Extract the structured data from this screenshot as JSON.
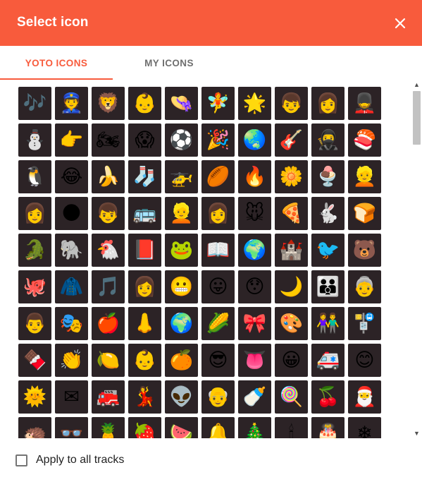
{
  "dialog": {
    "title": "Select icon"
  },
  "tabs": [
    {
      "label": "YOTO ICONS",
      "active": true
    },
    {
      "label": "MY ICONS",
      "active": false
    }
  ],
  "footer": {
    "apply_label": "Apply to all tracks",
    "apply_checked": false
  },
  "colors": {
    "accent": "#f85b3c",
    "tile_bg": "#2c2326"
  },
  "icons": [
    [
      "🎶",
      "👮",
      "🦁",
      "👶",
      "👒",
      "🧚",
      "🌟",
      "👦",
      "👩",
      "💂"
    ],
    [
      "⛄",
      "👉",
      "🏍",
      "😱",
      "⚽",
      "🎉",
      "🌏",
      "🎸",
      "🥷",
      "🍣"
    ],
    [
      "🐧",
      "😂",
      "🍌",
      "🧦",
      "🚁",
      "🏉",
      "🔥",
      "🌼",
      "🍨",
      "👱"
    ],
    [
      "👩",
      "🌑",
      "👦",
      "🚌",
      "👱",
      "👩",
      "🐭",
      "🍕",
      "🐇",
      "🍞"
    ],
    [
      "🐊",
      "🐘",
      "🐔",
      "📕",
      "🐸",
      "📖",
      "🌍",
      "🏰",
      "🐦",
      "🐻"
    ],
    [
      "🐙",
      "🧥",
      "🎵",
      "👩",
      "😬",
      "😛",
      "😯",
      "🌙",
      "👪",
      "👵"
    ],
    [
      "👨",
      "🎭",
      "🍎",
      "👃",
      "🌍",
      "🌽",
      "🎀",
      "🎨",
      "👫",
      "🚏"
    ],
    [
      "🍫",
      "👏",
      "🍋",
      "👶",
      "🍊",
      "😎",
      "👅",
      "😀",
      "🚑",
      "😊"
    ],
    [
      "🌞",
      "✉",
      "🚒",
      "💃",
      "👽",
      "👴",
      "🍼",
      "🍭",
      "🍒",
      "🎅"
    ],
    [
      "🦔",
      "👓",
      "🍍",
      "🍓",
      "🍉",
      "🔔",
      "🎄",
      "🕯",
      "🎂",
      "❄"
    ]
  ]
}
